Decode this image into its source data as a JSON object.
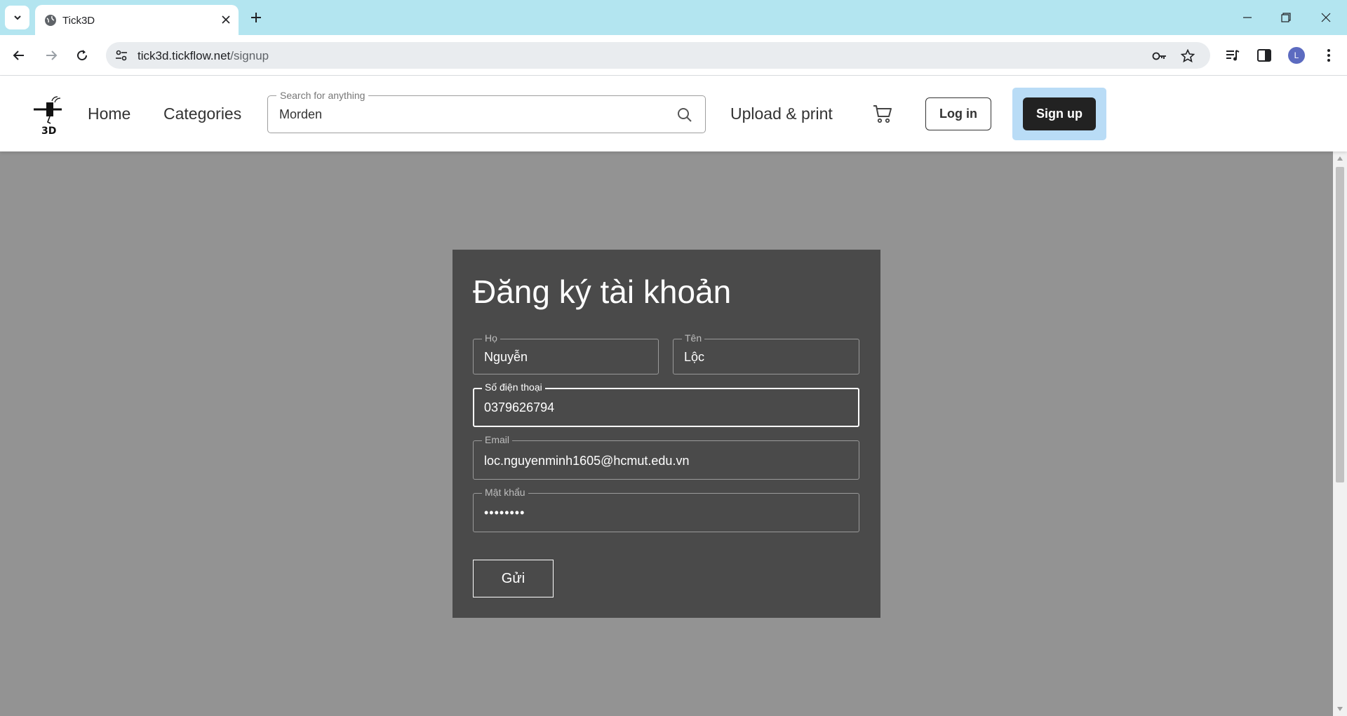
{
  "browser": {
    "tab_title": "Tick3D",
    "url_host": "tick3d.tickflow.net",
    "url_path": "/signup",
    "profile_initial": "L"
  },
  "header": {
    "nav": {
      "home": "Home",
      "categories": "Categories",
      "upload": "Upload & print"
    },
    "search": {
      "label": "Search for anything",
      "value": "Morden"
    },
    "login_label": "Log in",
    "signup_label": "Sign up"
  },
  "form": {
    "title": "Đăng ký tài khoản",
    "last_name": {
      "label": "Họ",
      "value": "Nguyễn"
    },
    "first_name": {
      "label": "Tên",
      "value": "Lộc"
    },
    "phone": {
      "label": "Số điện thoại",
      "value": "0379626794"
    },
    "email": {
      "label": "Email",
      "value": "loc.nguyenminh1605@hcmut.edu.vn"
    },
    "password": {
      "label": "Mật khẩu",
      "value": "••••••••"
    },
    "submit_label": "Gửi"
  },
  "colors": {
    "tabstrip": "#b3e5f0",
    "page_bg": "#939393",
    "card_bg": "#4a4a4a",
    "signup_highlight": "#b9dcf6"
  }
}
